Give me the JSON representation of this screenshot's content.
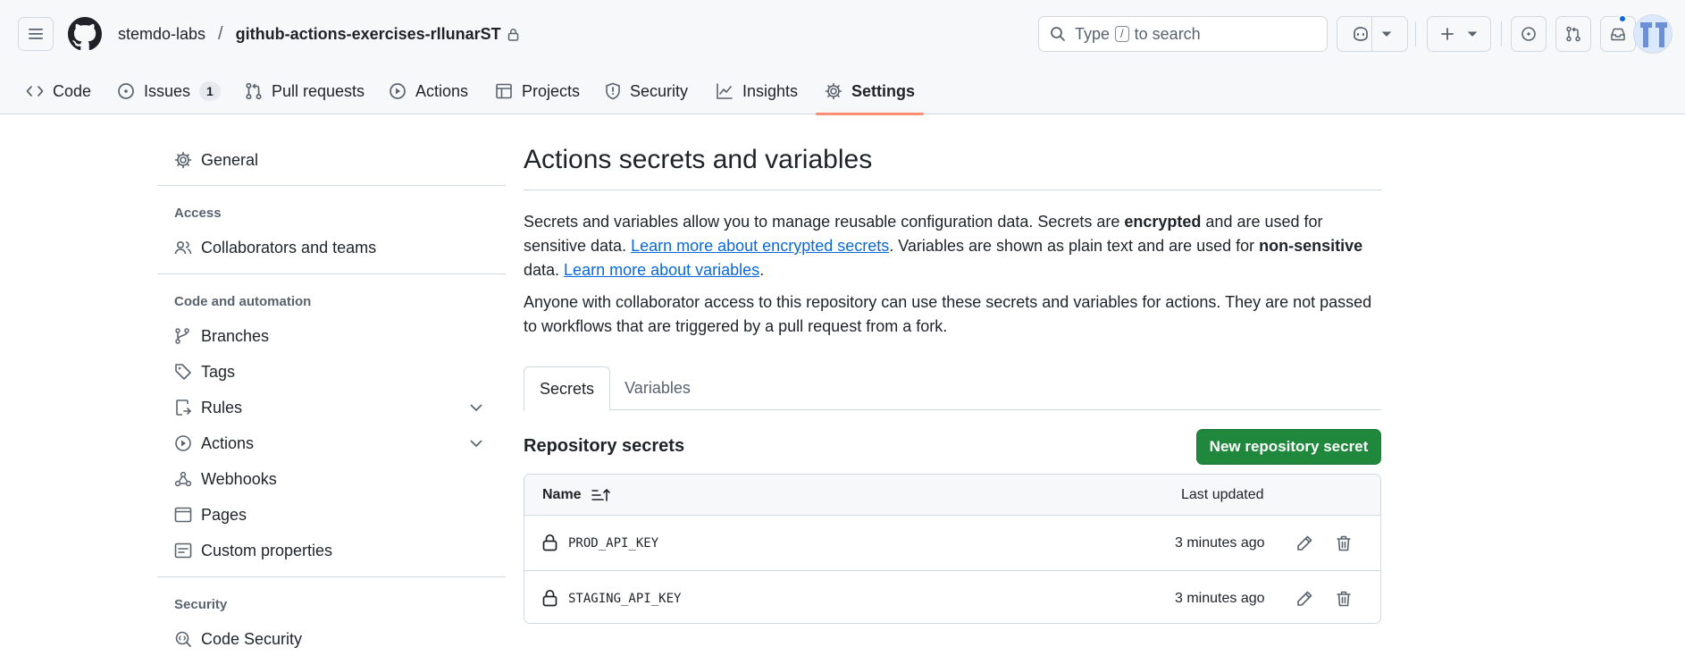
{
  "header": {
    "owner": "stemdo-labs",
    "separator": "/",
    "repo": "github-actions-exercises-rllunarST",
    "search": {
      "prefix": "Type",
      "key": "/",
      "suffix": "to search"
    }
  },
  "repo_tabs": [
    {
      "label": "Code",
      "icon": "code-icon"
    },
    {
      "label": "Issues",
      "icon": "issue-icon",
      "count": "1"
    },
    {
      "label": "Pull requests",
      "icon": "git-pull-request-icon"
    },
    {
      "label": "Actions",
      "icon": "play-icon"
    },
    {
      "label": "Projects",
      "icon": "table-icon"
    },
    {
      "label": "Security",
      "icon": "shield-icon"
    },
    {
      "label": "Insights",
      "icon": "graph-icon"
    },
    {
      "label": "Settings",
      "icon": "gear-icon",
      "active": true
    }
  ],
  "sidebar": {
    "general": "General",
    "sections": [
      {
        "heading": "Access",
        "items": [
          "Collaborators and teams"
        ]
      },
      {
        "heading": "Code and automation",
        "items": [
          "Branches",
          "Tags",
          "Rules",
          "Actions",
          "Webhooks",
          "Pages",
          "Custom properties"
        ]
      },
      {
        "heading": "Security",
        "items": [
          "Code Security"
        ]
      }
    ]
  },
  "main": {
    "title": "Actions secrets and variables",
    "p1": {
      "t1": "Secrets and variables allow you to manage reusable configuration data. Secrets are ",
      "b1": "encrypted",
      "t2": " and are used for sensitive data. ",
      "link1": "Learn more about encrypted secrets",
      "t3": ". Variables are shown as plain text and are used for ",
      "b2": "non-sensitive",
      "t4": " data. ",
      "link2": "Learn more about variables",
      "t5": "."
    },
    "p2": "Anyone with collaborator access to this repository can use these secrets and variables for actions. They are not passed to workflows that are triggered by a pull request from a fork.",
    "tabs": [
      "Secrets",
      "Variables"
    ],
    "section_title": "Repository secrets",
    "new_button": "New repository secret",
    "table": {
      "col_name": "Name",
      "col_updated": "Last updated",
      "rows": [
        {
          "name": "PROD_API_KEY",
          "updated": "3 minutes ago"
        },
        {
          "name": "STAGING_API_KEY",
          "updated": "3 minutes ago"
        }
      ]
    }
  },
  "colors": {
    "accent": "#0969da",
    "primary_button": "#1f883d",
    "active_tab_underline": "#fd8c73"
  }
}
